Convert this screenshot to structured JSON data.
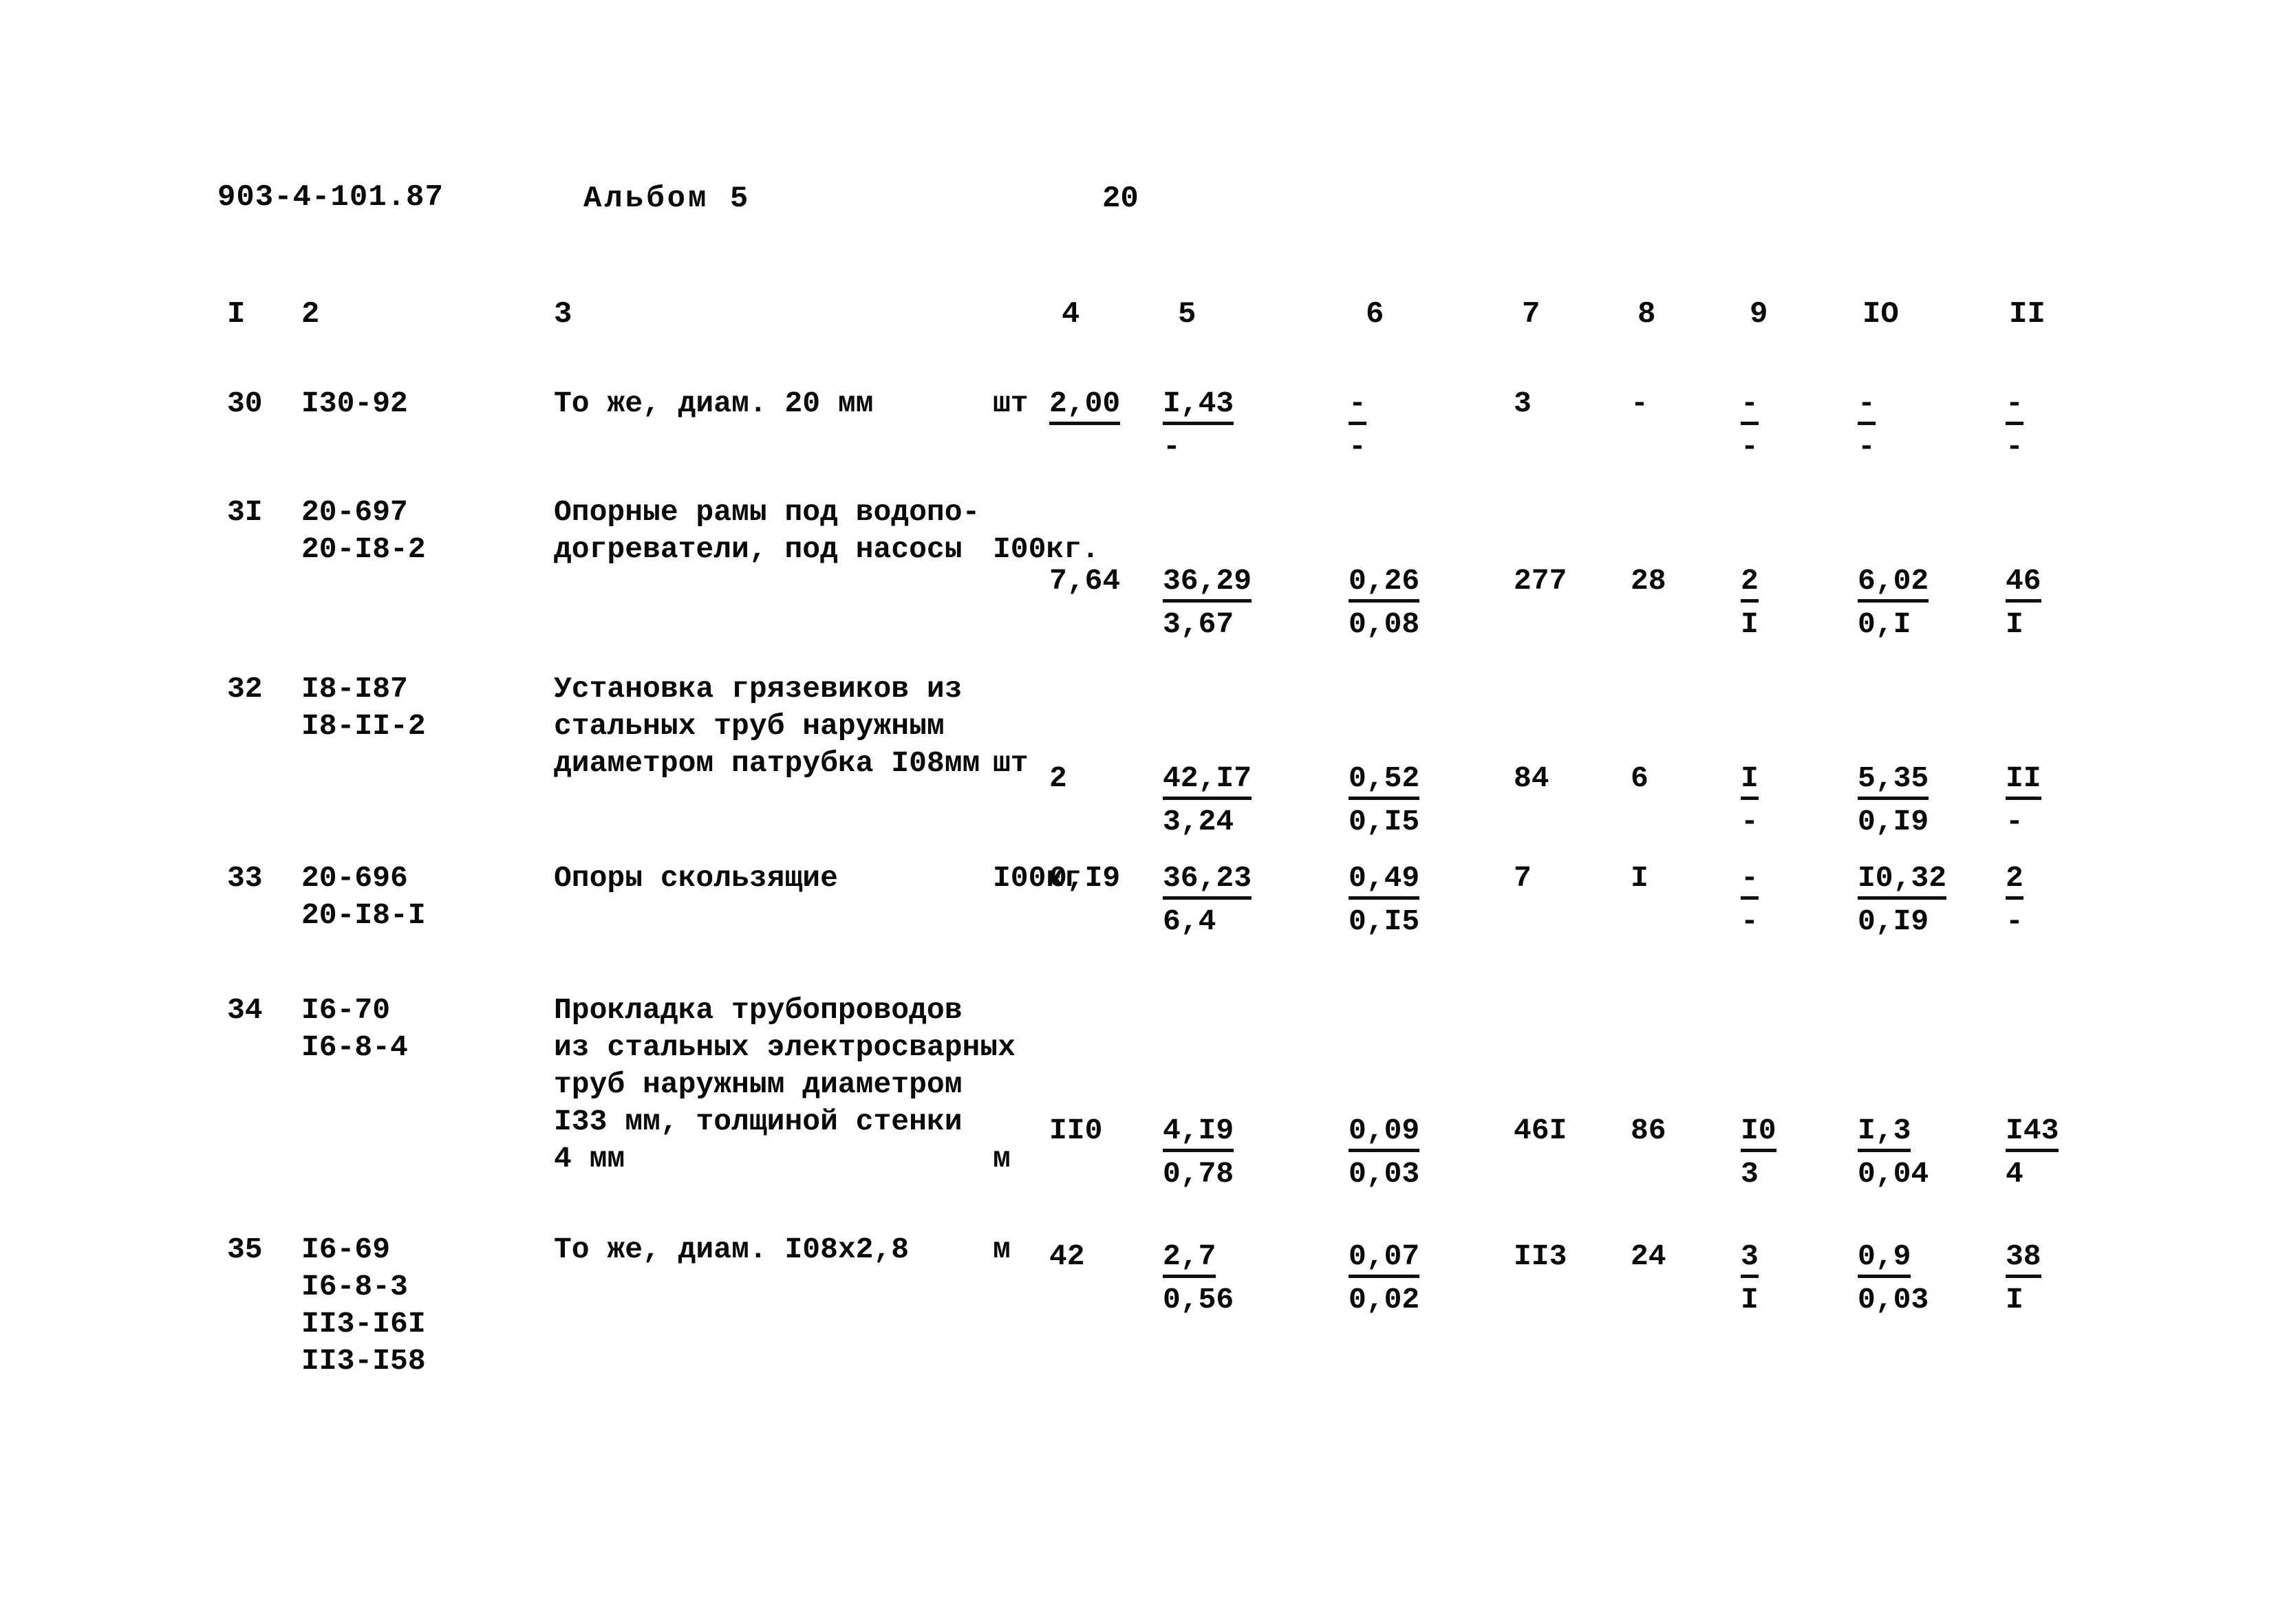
{
  "header": {
    "doc_code": "903-4-101.87",
    "album": "Альбом 5",
    "page_number": "20"
  },
  "table": {
    "column_headers": [
      "I",
      "2",
      "3",
      "4",
      "5",
      "6",
      "7",
      "8",
      "9",
      "IO",
      "II"
    ],
    "rows": [
      {
        "no": "30",
        "codes": [
          "I30-92"
        ],
        "description": [
          "То же, диам. 20 мм"
        ],
        "unit": "шт",
        "c4": "2,00",
        "c4_under": "",
        "c5_num": "I,43",
        "c5_den": "-",
        "c6_num": "-",
        "c6_den": "-",
        "c7": "3",
        "c8": "-",
        "c9_num": "-",
        "c9_den": "-",
        "c10_num": "-",
        "c10_den": "-",
        "c11_num": "-",
        "c11_den": "-"
      },
      {
        "no": "3I",
        "codes": [
          "20-697",
          "20-I8-2"
        ],
        "description": [
          "Опорные рамы под водопо-",
          "догреватели, под насосы"
        ],
        "unit": "I00кг.",
        "c4": "7,64",
        "c5_num": "36,29",
        "c5_den": "3,67",
        "c6_num": "0,26",
        "c6_den": "0,08",
        "c7": "277",
        "c8": "28",
        "c9_num": "2",
        "c9_den": "I",
        "c10_num": "6,02",
        "c10_den": "0,I",
        "c11_num": "46",
        "c11_den": "I"
      },
      {
        "no": "32",
        "codes": [
          "I8-I87",
          "I8-II-2"
        ],
        "description": [
          "Установка грязевиков из",
          "стальных труб наружным",
          "диаметром патрубка I08мм"
        ],
        "unit": "шт",
        "c4": "2",
        "c5_num": "42,I7",
        "c5_den": "3,24",
        "c6_num": "0,52",
        "c6_den": "0,I5",
        "c7": "84",
        "c8": "6",
        "c9_num": "I",
        "c9_den": "-",
        "c10_num": "5,35",
        "c10_den": "0,I9",
        "c11_num": "II",
        "c11_den": "-"
      },
      {
        "no": "33",
        "codes": [
          "20-696",
          "20-I8-I"
        ],
        "description": [
          "Опоры скользящие"
        ],
        "unit": "I00кг",
        "c4": "0,I9",
        "c5_num": "36,23",
        "c5_den": "6,4",
        "c6_num": "0,49",
        "c6_den": "0,I5",
        "c7": "7",
        "c8": "I",
        "c9_num": "-",
        "c9_den": "-",
        "c10_num": "I0,32",
        "c10_den": "0,I9",
        "c11_num": "2",
        "c11_den": "-"
      },
      {
        "no": "34",
        "codes": [
          "I6-70",
          "I6-8-4"
        ],
        "description": [
          "Прокладка трубопроводов",
          "из стальных электросварных",
          "труб наружным диаметром",
          "I33 мм, толщиной стенки",
          "4 мм"
        ],
        "unit": "м",
        "c4": "II0",
        "c5_num": "4,I9",
        "c5_den": "0,78",
        "c6_num": "0,09",
        "c6_den": "0,03",
        "c7": "46I",
        "c8": "86",
        "c9_num": "I0",
        "c9_den": "3",
        "c10_num": "I,3",
        "c10_den": "0,04",
        "c11_num": "I43",
        "c11_den": "4"
      },
      {
        "no": "35",
        "codes": [
          "I6-69",
          "I6-8-3",
          "II3-I6I",
          "II3-I58"
        ],
        "description": [
          "То же, диам. I08х2,8"
        ],
        "unit": "м",
        "c4": "42",
        "c5_num": "2,7",
        "c5_den": "0,56",
        "c6_num": "0,07",
        "c6_den": "0,02",
        "c7": "II3",
        "c8": "24",
        "c9_num": "3",
        "c9_den": "I",
        "c10_num": "0,9",
        "c10_den": "0,03",
        "c11_num": "38",
        "c11_den": "I"
      }
    ]
  },
  "style": {
    "ink_color": "#101010",
    "paper_color": "#ffffff",
    "rule_dash_text": "- - - - - - - - - - - - - - - - - - - - - - - - - - - - - - - - - - - - - - - - - - - - - - - - - - - - - - - - - - - - - - - -"
  }
}
